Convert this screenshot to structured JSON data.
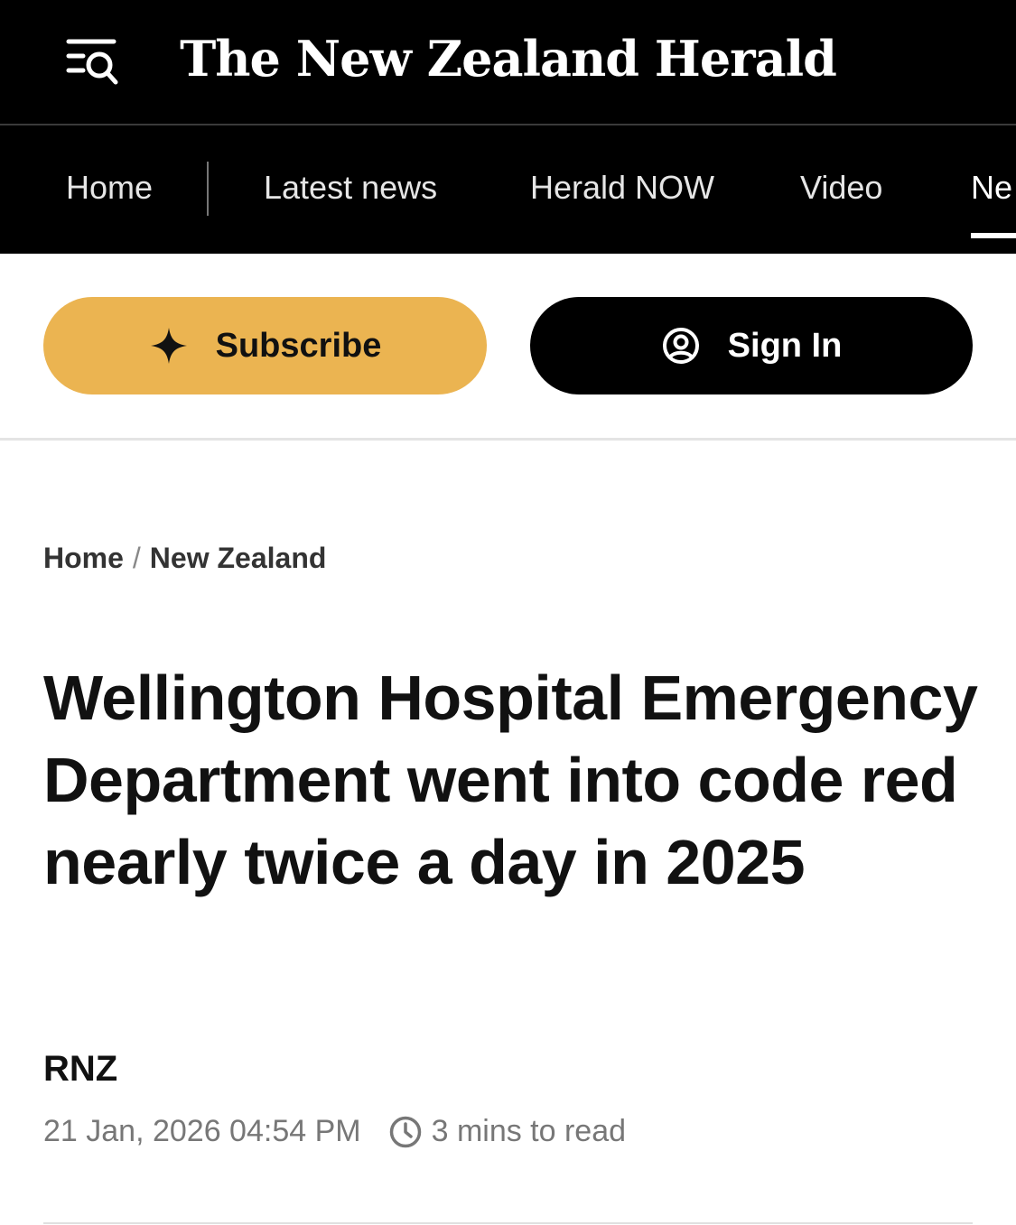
{
  "header": {
    "logo_text": "The New Zealand Herald",
    "menu_icon": "menu-search-icon"
  },
  "nav": {
    "items": [
      {
        "label": "Home"
      },
      {
        "label": "Latest news"
      },
      {
        "label": "Herald NOW"
      },
      {
        "label": "Video"
      },
      {
        "label": "Ne"
      }
    ]
  },
  "actions": {
    "subscribe_label": "Subscribe",
    "subscribe_icon": "sparkle-icon",
    "signin_label": "Sign In",
    "signin_icon": "user-circle-icon",
    "subscribe_color": "#ebb451"
  },
  "breadcrumb": {
    "items": [
      "Home",
      "New Zealand"
    ],
    "separator": "/"
  },
  "article": {
    "headline": "Wellington Hospital Emergency Department went into code red nearly twice a day in 2025",
    "author": "RNZ",
    "published": "21 Jan, 2026 04:54 PM",
    "read_time": "3 mins to read",
    "read_time_icon": "clock-icon"
  }
}
